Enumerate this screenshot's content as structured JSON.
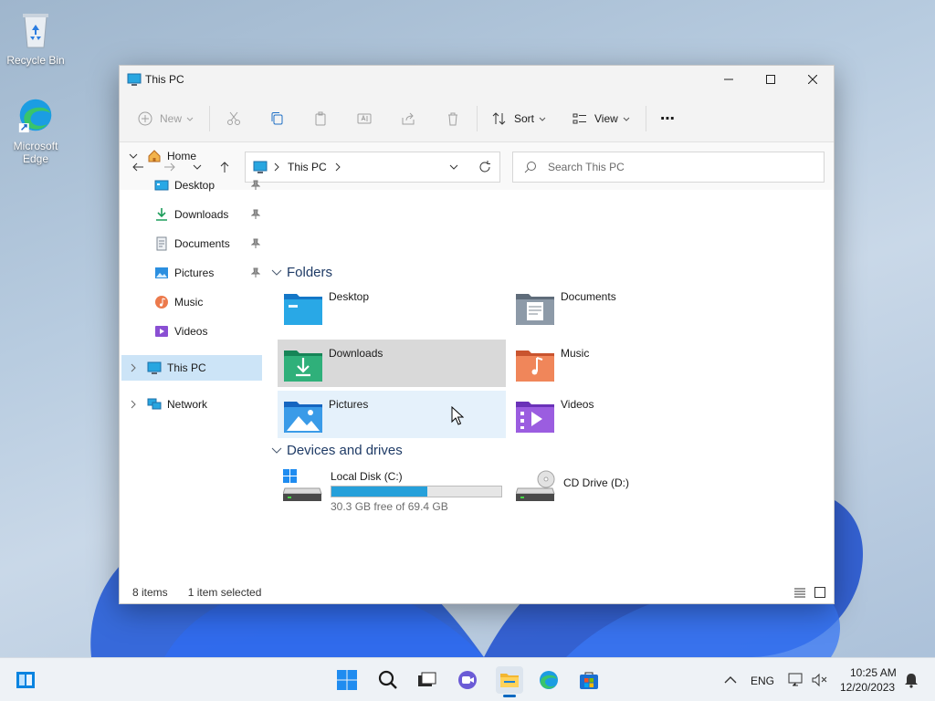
{
  "desktop": {
    "icons": [
      {
        "label": "Recycle Bin",
        "icon": "recycle-bin-icon"
      },
      {
        "label": "Microsoft Edge",
        "icon": "edge-icon"
      }
    ]
  },
  "window": {
    "title": "This PC",
    "controls": [
      "minimize",
      "maximize",
      "close"
    ]
  },
  "toolbar": {
    "new_label": "New",
    "sort_label": "Sort",
    "view_label": "View",
    "more_label": "⋯",
    "actions": [
      "cut",
      "copy",
      "paste",
      "rename",
      "share",
      "delete"
    ]
  },
  "addressbar": {
    "path_label": "This PC",
    "search_placeholder": "Search This PC"
  },
  "sidebar": {
    "items": [
      {
        "label": "Home",
        "icon": "home-icon"
      },
      {
        "label": "Desktop",
        "icon": "desktop-folder-icon",
        "pinned": true
      },
      {
        "label": "Downloads",
        "icon": "download-icon",
        "pinned": true
      },
      {
        "label": "Documents",
        "icon": "documents-icon",
        "pinned": true
      },
      {
        "label": "Pictures",
        "icon": "pictures-icon",
        "pinned": true
      },
      {
        "label": "Music",
        "icon": "music-icon"
      },
      {
        "label": "Videos",
        "icon": "videos-icon"
      },
      {
        "label": "This PC",
        "icon": "this-pc-icon",
        "selected": true
      },
      {
        "label": "Network",
        "icon": "network-icon"
      }
    ]
  },
  "content": {
    "folders_header": "Folders",
    "folders": [
      {
        "label": "Desktop"
      },
      {
        "label": "Documents"
      },
      {
        "label": "Downloads",
        "selected": true
      },
      {
        "label": "Music"
      },
      {
        "label": "Pictures",
        "hover": true
      },
      {
        "label": "Videos"
      }
    ],
    "drives_header": "Devices and drives",
    "drives": [
      {
        "label": "Local Disk (C:)",
        "free_text": "30.3 GB free of 69.4 GB",
        "used_fraction": 0.563
      },
      {
        "label": "CD Drive (D:)"
      }
    ]
  },
  "statusbar": {
    "items_count": "8 items",
    "selection": "1 item selected"
  },
  "taskbar": {
    "language": "ENG",
    "time": "10:25 AM",
    "date": "12/20/2023",
    "accent": "#0067c0"
  }
}
